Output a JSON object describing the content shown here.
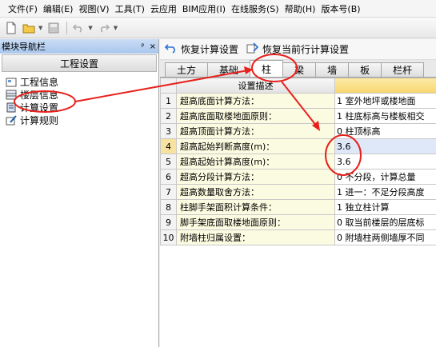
{
  "menu": [
    "文件(F)",
    "编辑(E)",
    "视图(V)",
    "工具(T)",
    "云应用",
    "BIM应用(I)",
    "在线服务(S)",
    "帮助(H)",
    "版本号(B)"
  ],
  "toolbar": {
    "icons": [
      "new-file-icon",
      "open-folder-icon",
      "save-icon",
      "undo-icon",
      "redo-icon"
    ]
  },
  "left_panel": {
    "title": "模块导航栏",
    "pin": "ᵖ",
    "close": "×",
    "tab": "工程设置",
    "items": [
      {
        "label": "工程信息",
        "icon": "project-info-icon"
      },
      {
        "label": "楼层信息",
        "icon": "floor-info-icon"
      },
      {
        "label": "计算设置",
        "icon": "calc-settings-icon"
      },
      {
        "label": "计算规则",
        "icon": "calc-rules-icon"
      }
    ]
  },
  "right_toolbar": {
    "restore_all": "恢复计算设置",
    "restore_row": "恢复当前行计算设置"
  },
  "tabs": [
    "土方",
    "基础",
    "柱",
    "梁",
    "墙",
    "板",
    "栏杆"
  ],
  "active_tab": "柱",
  "table": {
    "header": "设置描述",
    "rows": [
      {
        "n": "1",
        "desc": "超高底面计算方法：",
        "val": "1 室外地坪或楼地面"
      },
      {
        "n": "2",
        "desc": "超高底面取楼地面原则：",
        "val": "1 柱底标高与楼板相交"
      },
      {
        "n": "3",
        "desc": "超高顶面计算方法：",
        "val": "0 柱顶标高"
      },
      {
        "n": "4",
        "desc": "超高起始判断高度(m)：",
        "val": "3.6"
      },
      {
        "n": "5",
        "desc": "超高起始计算高度(m)：",
        "val": "3.6"
      },
      {
        "n": "6",
        "desc": "超高分段计算方法：",
        "val": "0 不分段，计算总量"
      },
      {
        "n": "7",
        "desc": "超高数量取舍方法：",
        "val": "1 进一：不足分段高度"
      },
      {
        "n": "8",
        "desc": "柱脚手架面积计算条件：",
        "val": "1 独立柱计算"
      },
      {
        "n": "9",
        "desc": "脚手架底面取楼地面原则：",
        "val": "0 取当前楼层的层底标"
      },
      {
        "n": "10",
        "desc": "附墙柱归属设置：",
        "val": "0 附墙柱两侧墙厚不同"
      }
    ]
  },
  "colors": {
    "annotation": "#e8201c",
    "title_bar": "#a9c6ec",
    "header_value": "#f7d66c"
  }
}
